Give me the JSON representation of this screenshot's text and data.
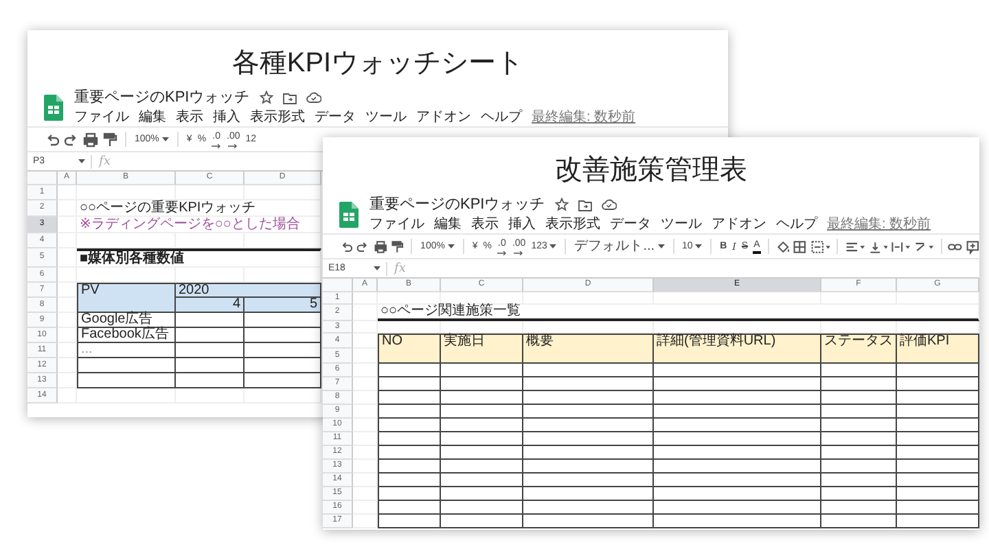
{
  "sheets": [
    {
      "heading": "各種KPIウォッチシート",
      "doc_title": "重要ページのKPIウォッチ",
      "menu": [
        "ファイル",
        "編集",
        "表示",
        "挿入",
        "表示形式",
        "データ",
        "ツール",
        "アドオン",
        "ヘルプ"
      ],
      "last_edit": "最終編集: 数秒前",
      "toolbar": [
        {
          "kind": "undo"
        },
        {
          "kind": "redo"
        },
        {
          "kind": "print"
        },
        {
          "kind": "paint-format"
        },
        {
          "kind": "sep"
        },
        {
          "kind": "dropdown",
          "text": "100%"
        },
        {
          "kind": "sep"
        },
        {
          "kind": "text",
          "text": "¥"
        },
        {
          "kind": "text",
          "text": "%"
        },
        {
          "kind": "decimal",
          "text": ".0"
        },
        {
          "kind": "decimal",
          "text": ".00"
        },
        {
          "kind": "text",
          "text": "12"
        }
      ],
      "cell_ref": "P3",
      "fx": "fx",
      "columns": [
        {
          "label": "A",
          "selected": false
        },
        {
          "label": "B",
          "selected": false
        },
        {
          "label": "C",
          "selected": false
        },
        {
          "label": "D",
          "selected": false
        }
      ],
      "rows": [
        {
          "number": "1",
          "selected": false,
          "kind": "blank"
        },
        {
          "number": "2",
          "selected": false,
          "kind": "text",
          "text": "○○ページの重要KPIウォッチ"
        },
        {
          "number": "3",
          "selected": true,
          "kind": "note",
          "text": "※ラディングページを○○とした場合"
        },
        {
          "number": "4",
          "selected": false,
          "kind": "blank"
        },
        {
          "number": "5",
          "selected": false,
          "kind": "section",
          "text": "■媒体別各種数値"
        },
        {
          "number": "6",
          "selected": false,
          "kind": "blank"
        },
        {
          "number": "7",
          "selected": false,
          "kind": "pivot-head-top",
          "label": "PV",
          "year": "2020"
        },
        {
          "number": "8",
          "selected": false,
          "kind": "pivot-head-bottom",
          "months": [
            "4",
            "5"
          ]
        },
        {
          "number": "9",
          "selected": false,
          "kind": "table-row",
          "cells": [
            "Google広告"
          ]
        },
        {
          "number": "10",
          "selected": false,
          "kind": "table-row",
          "cells": [
            "Facebook広告"
          ]
        },
        {
          "number": "11",
          "selected": false,
          "kind": "table-row",
          "cells": [
            "..."
          ]
        },
        {
          "number": "12",
          "selected": false,
          "kind": "table-row"
        },
        {
          "number": "13",
          "selected": false,
          "kind": "table-row"
        },
        {
          "number": "14",
          "selected": false,
          "kind": "blank"
        }
      ]
    },
    {
      "heading": "改善施策管理表",
      "doc_title": "重要ページのKPIウォッチ",
      "menu": [
        "ファイル",
        "編集",
        "表示",
        "挿入",
        "表示形式",
        "データ",
        "ツール",
        "アドオン",
        "ヘルプ"
      ],
      "last_edit": "最終編集: 数秒前",
      "toolbar": [
        {
          "kind": "undo"
        },
        {
          "kind": "redo"
        },
        {
          "kind": "print"
        },
        {
          "kind": "paint-format"
        },
        {
          "kind": "sep"
        },
        {
          "kind": "dropdown",
          "text": "100%"
        },
        {
          "kind": "sep"
        },
        {
          "kind": "text",
          "text": "¥"
        },
        {
          "kind": "text",
          "text": "%"
        },
        {
          "kind": "decimal",
          "text": ".0"
        },
        {
          "kind": "decimal",
          "text": ".00"
        },
        {
          "kind": "dropdown",
          "text": "123"
        },
        {
          "kind": "sep"
        },
        {
          "kind": "dropdown",
          "text": "デフォルト..."
        },
        {
          "kind": "sep"
        },
        {
          "kind": "dropdown",
          "text": "10"
        },
        {
          "kind": "sep"
        },
        {
          "kind": "bold",
          "text": "B"
        },
        {
          "kind": "italic",
          "text": "I"
        },
        {
          "kind": "strike",
          "text": "S"
        },
        {
          "kind": "text-color",
          "text": "A"
        },
        {
          "kind": "sep"
        },
        {
          "kind": "fill"
        },
        {
          "kind": "borders"
        },
        {
          "kind": "merge"
        },
        {
          "kind": "sep"
        },
        {
          "kind": "align"
        },
        {
          "kind": "valign"
        },
        {
          "kind": "wrap"
        },
        {
          "kind": "rotate"
        },
        {
          "kind": "sep"
        },
        {
          "kind": "link"
        },
        {
          "kind": "comment"
        }
      ],
      "cell_ref": "E18",
      "fx": "fx",
      "columns": [
        {
          "label": "A",
          "selected": false
        },
        {
          "label": "B",
          "selected": false
        },
        {
          "label": "C",
          "selected": false
        },
        {
          "label": "D",
          "selected": false
        },
        {
          "label": "E",
          "selected": true
        },
        {
          "label": "F",
          "selected": false
        },
        {
          "label": "G",
          "selected": false
        }
      ],
      "rows": [
        {
          "number": "1",
          "selected": false,
          "kind": "blank"
        },
        {
          "number": "2",
          "selected": false,
          "kind": "underlined-text",
          "text": "○○ページ関連施策一覧"
        },
        {
          "number": "3",
          "selected": false,
          "kind": "blank"
        },
        {
          "number": "4",
          "selected": false,
          "kind": "table-head-top",
          "cells": [
            "NO",
            "実施日",
            "概要",
            "詳細(管理資料URL)",
            "ステータス",
            "評価KPI"
          ]
        },
        {
          "number": "5",
          "selected": false,
          "kind": "table-head-bottom"
        },
        {
          "number": "6",
          "selected": false,
          "kind": "table-row"
        },
        {
          "number": "7",
          "selected": false,
          "kind": "table-row"
        },
        {
          "number": "8",
          "selected": false,
          "kind": "table-row"
        },
        {
          "number": "9",
          "selected": false,
          "kind": "table-row"
        },
        {
          "number": "10",
          "selected": false,
          "kind": "table-row"
        },
        {
          "number": "11",
          "selected": false,
          "kind": "table-row"
        },
        {
          "number": "12",
          "selected": false,
          "kind": "table-row"
        },
        {
          "number": "13",
          "selected": false,
          "kind": "table-row"
        },
        {
          "number": "14",
          "selected": false,
          "kind": "table-row"
        },
        {
          "number": "15",
          "selected": false,
          "kind": "table-row"
        },
        {
          "number": "16",
          "selected": false,
          "kind": "table-row"
        },
        {
          "number": "17",
          "selected": false,
          "kind": "table-row"
        }
      ]
    }
  ]
}
